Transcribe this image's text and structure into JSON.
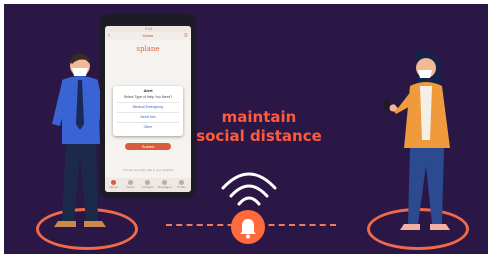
{
  "headline": {
    "line1": "maintain",
    "line2": "social distance"
  },
  "phone": {
    "status_time": "9:41",
    "app_title": "Home",
    "logo_text": "splane",
    "dialog": {
      "title": "Alert",
      "subtitle": "Select Type of Help You Need?",
      "options": [
        "Medical Emergency",
        "Need Info",
        "Other"
      ]
    },
    "submit_label": "Submit",
    "note": "You are currently safe in your location",
    "tabs": [
      "Home",
      "Alerts",
      "Contacts",
      "Messages",
      "Profile"
    ]
  },
  "colors": {
    "background": "#2a1746",
    "accent": "#ff5a3c",
    "ring": "#f06a4a"
  },
  "icons": {
    "bell": "bell-icon",
    "signal": "signal-waves-icon"
  }
}
